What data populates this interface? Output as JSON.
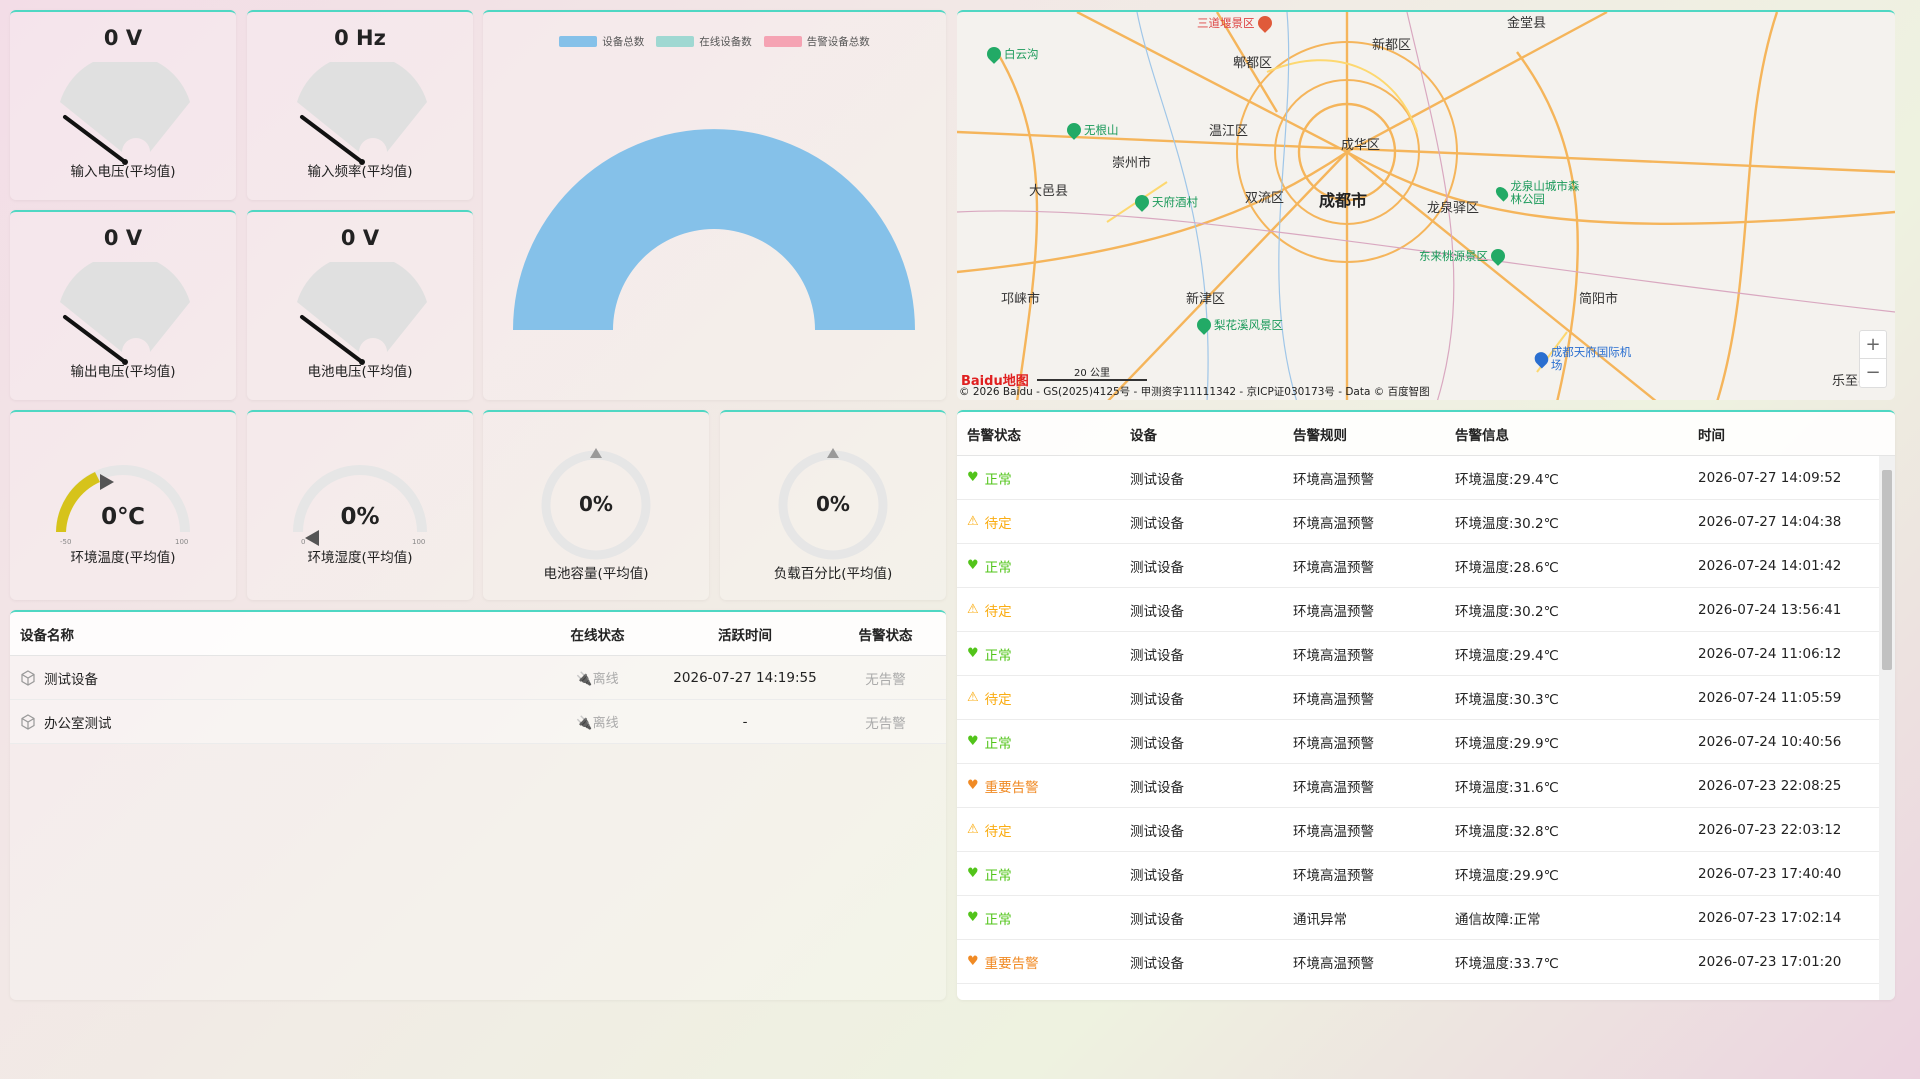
{
  "gauges": [
    {
      "value": "0 V",
      "label": "输入电压(平均值)"
    },
    {
      "value": "0 Hz",
      "label": "输入频率(平均值)"
    },
    {
      "value": "0 V",
      "label": "输出电压(平均值)"
    },
    {
      "value": "0 V",
      "label": "电池电压(平均值)"
    }
  ],
  "temp": {
    "value": "0℃",
    "label": "环境温度(平均值)",
    "min": "-50",
    "max": "100"
  },
  "humidity": {
    "value": "0%",
    "label": "环境湿度(平均值)",
    "min": "0",
    "max": "100"
  },
  "battery": {
    "value": "0%",
    "label": "电池容量(平均值)"
  },
  "load": {
    "value": "0%",
    "label": "负载百分比(平均值)"
  },
  "device_chart": {
    "legend": [
      "设备总数",
      "在线设备数",
      "告警设备总数"
    ],
    "colors": [
      "#85c1e9",
      "#9fd8d2",
      "#f5a3b3"
    ]
  },
  "device_table": {
    "headers": [
      "设备名称",
      "在线状态",
      "活跃时间",
      "告警状态"
    ],
    "rows": [
      {
        "name": "测试设备",
        "online": "离线",
        "active": "2026-07-27 14:19:55",
        "alarm": "无告警"
      },
      {
        "name": "办公室测试",
        "online": "离线",
        "active": "-",
        "alarm": "无告警"
      }
    ]
  },
  "map": {
    "places": [
      "金堂县",
      "新都区",
      "郫都区",
      "温江区",
      "成华区",
      "崇州市",
      "大邑县",
      "双流区",
      "成都市",
      "龙泉驿区",
      "邛崃市",
      "新津区",
      "简阳市",
      "乐至县"
    ],
    "pois": [
      "三道堰景区",
      "白云沟",
      "无根山",
      "天府酒村",
      "龙泉山城市森林公园",
      "东来桃源景区",
      "梨花溪风景区",
      "成都天府国际机场"
    ],
    "scale": "20 公里",
    "copyright": "© 2026 Baidu - GS(2025)4125号 - 甲测资字11111342 - 京ICP证030173号 - Data © 百度智图",
    "logo": "Baidu地图",
    "zoom_in": "+",
    "zoom_out": "−"
  },
  "alarm_table": {
    "headers": [
      "告警状态",
      "设备",
      "告警规则",
      "告警信息",
      "时间"
    ],
    "rows": [
      {
        "status": "正常",
        "kind": "ok",
        "device": "测试设备",
        "rule": "环境高温预警",
        "info": "环境温度:29.4℃",
        "time": "2026-07-27 14:09:52"
      },
      {
        "status": "待定",
        "kind": "pending",
        "device": "测试设备",
        "rule": "环境高温预警",
        "info": "环境温度:30.2℃",
        "time": "2026-07-27 14:04:38"
      },
      {
        "status": "正常",
        "kind": "ok",
        "device": "测试设备",
        "rule": "环境高温预警",
        "info": "环境温度:28.6℃",
        "time": "2026-07-24 14:01:42"
      },
      {
        "status": "待定",
        "kind": "pending",
        "device": "测试设备",
        "rule": "环境高温预警",
        "info": "环境温度:30.2℃",
        "time": "2026-07-24 13:56:41"
      },
      {
        "status": "正常",
        "kind": "ok",
        "device": "测试设备",
        "rule": "环境高温预警",
        "info": "环境温度:29.4℃",
        "time": "2026-07-24 11:06:12"
      },
      {
        "status": "待定",
        "kind": "pending",
        "device": "测试设备",
        "rule": "环境高温预警",
        "info": "环境温度:30.3℃",
        "time": "2026-07-24 11:05:59"
      },
      {
        "status": "正常",
        "kind": "ok",
        "device": "测试设备",
        "rule": "环境高温预警",
        "info": "环境温度:29.9℃",
        "time": "2026-07-24 10:40:56"
      },
      {
        "status": "重要告警",
        "kind": "major",
        "device": "测试设备",
        "rule": "环境高温预警",
        "info": "环境温度:31.6℃",
        "time": "2026-07-23 22:08:25"
      },
      {
        "status": "待定",
        "kind": "pending",
        "device": "测试设备",
        "rule": "环境高温预警",
        "info": "环境温度:32.8℃",
        "time": "2026-07-23 22:03:12"
      },
      {
        "status": "正常",
        "kind": "ok",
        "device": "测试设备",
        "rule": "环境高温预警",
        "info": "环境温度:29.9℃",
        "time": "2026-07-23 17:40:40"
      },
      {
        "status": "正常",
        "kind": "ok",
        "device": "测试设备",
        "rule": "通讯异常",
        "info": "通信故障:正常",
        "time": "2026-07-23 17:02:14"
      },
      {
        "status": "重要告警",
        "kind": "major",
        "device": "测试设备",
        "rule": "环境高温预警",
        "info": "环境温度:33.7℃",
        "time": "2026-07-23 17:01:20"
      }
    ]
  }
}
